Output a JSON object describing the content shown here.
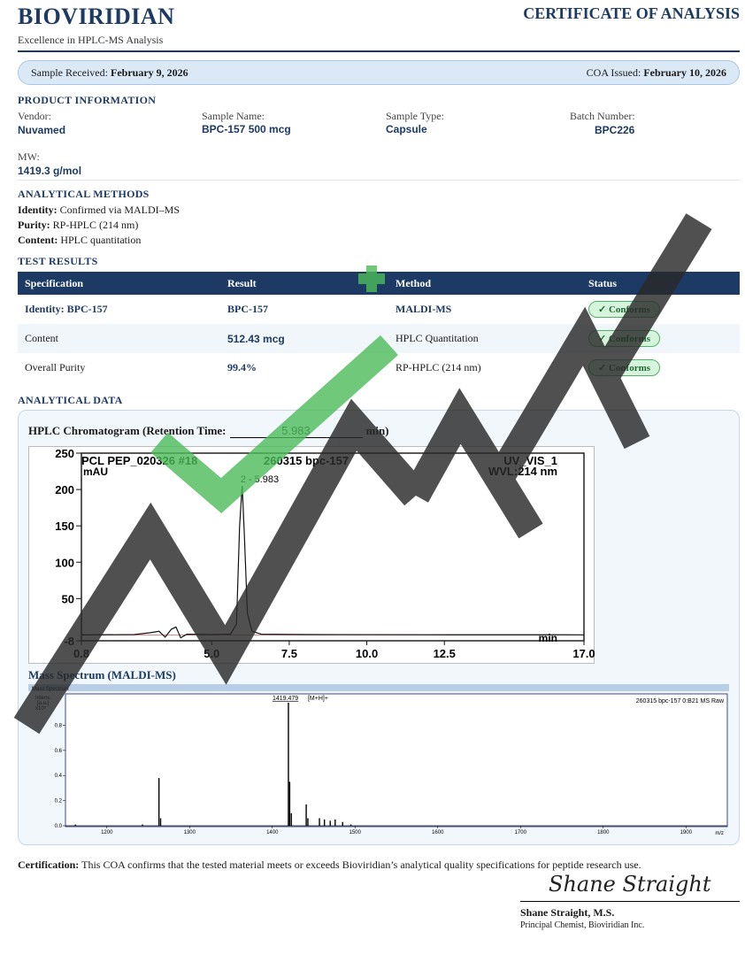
{
  "header": {
    "brand": "BIOVIRIDIAN",
    "tagline": "Excellence in HPLC-MS Analysis",
    "doc_title": "CERTIFICATE OF ANALYSIS"
  },
  "dates": {
    "received_label": "Sample Received:",
    "received_value": "February 9, 2026",
    "issued_label": "COA Issued:",
    "issued_value": "February 10, 2026"
  },
  "product": {
    "heading": "PRODUCT INFORMATION",
    "vendor_label": "Vendor:",
    "vendor": "Nuvamed",
    "sample_name_label": "Sample Name:",
    "sample_name": "BPC-157  500 mcg",
    "sample_type_label": "Sample Type:",
    "sample_type": "Capsule",
    "batch_label": "Batch Number:",
    "batch": "BPC226",
    "mw_label": "MW:",
    "mw": "1419.3  g/mol"
  },
  "methods": {
    "heading": "ANALYTICAL METHODS",
    "identity_label": "Identity:",
    "identity": "Confirmed via MALDI–MS",
    "purity_label": "Purity:",
    "purity": "RP-HPLC (214 nm)",
    "content_label": "Content:",
    "content": "HPLC quantitation"
  },
  "results": {
    "heading": "TEST RESULTS",
    "columns": [
      "Specification",
      "Result",
      "Method",
      "Status"
    ],
    "rows": [
      {
        "spec": "Identity:  BPC-157",
        "result": "BPC-157",
        "method": "MALDI-MS",
        "status": "✓ Conforms"
      },
      {
        "spec": "Content",
        "result": "512.43  mcg",
        "method": "HPLC Quantitation",
        "status": "✓ Conforms"
      },
      {
        "spec": "Overall Purity",
        "result": "99.4%",
        "method": "RP-HPLC (214 nm)",
        "status": "✓ Conforms"
      }
    ]
  },
  "analytical": {
    "heading": "ANALYTICAL DATA",
    "hplc_title_prefix": "HPLC Chromatogram (Retention Time:",
    "retention_time": "5.983",
    "hplc_title_suffix": "min)",
    "ms_title": "Mass Spectrum (MALDI-MS)"
  },
  "chart_data": [
    {
      "type": "line",
      "header_left": "PCL PEP_020326 #18",
      "header_mid": "260315 bpc-157",
      "header_right": "UV_VIS_1",
      "header_right2": "WVL:214 nm",
      "y_unit": "mAU",
      "x_unit": "min",
      "x_ticks": [
        "0.8",
        "5.0",
        "7.5",
        "10.0",
        "12.5",
        "17.0"
      ],
      "y_ticks": [
        "250",
        "200",
        "150",
        "100",
        "50",
        "-8"
      ],
      "xlim": [
        0.8,
        17.0
      ],
      "ylim": [
        -8,
        250
      ],
      "peak_label": "2 - 5.983",
      "x": [
        0.8,
        2.5,
        3.0,
        3.3,
        3.5,
        3.7,
        3.85,
        4.0,
        4.2,
        5.0,
        5.6,
        5.8,
        5.9,
        5.983,
        6.05,
        6.15,
        6.3,
        6.6,
        8.0,
        12.0,
        17.0
      ],
      "y": [
        0,
        0.5,
        3,
        5,
        -3,
        8,
        11,
        -4,
        1,
        0.5,
        1,
        15,
        150,
        205,
        140,
        30,
        5,
        1,
        0.5,
        0.3,
        0.2
      ]
    },
    {
      "type": "line",
      "header_tag": "Mass Spectrum",
      "header_right": "260315 bpc-157 0:B21 MS Raw",
      "y_label_1": "Intens.",
      "y_label_2": "[a.u.]",
      "y_label_3": "x10⁵",
      "x_unit": "m/z",
      "x_ticks": [
        "1200",
        "1300",
        "1400",
        "1500",
        "1600",
        "1700",
        "1800",
        "1900"
      ],
      "y_ticks": [
        "0.8",
        "0.6",
        "0.4",
        "0.2",
        "0.0"
      ],
      "xlim": [
        1150,
        1950
      ],
      "ylim": [
        0,
        1.05
      ],
      "peak_label": "1419.479",
      "peak_annotation": "[M+H]+",
      "peaks": [
        {
          "mz": 1162,
          "i": 0.01
        },
        {
          "mz": 1243,
          "i": 0.01
        },
        {
          "mz": 1263,
          "i": 0.38
        },
        {
          "mz": 1265,
          "i": 0.06
        },
        {
          "mz": 1419.479,
          "i": 0.98
        },
        {
          "mz": 1421,
          "i": 0.35
        },
        {
          "mz": 1423,
          "i": 0.1
        },
        {
          "mz": 1441,
          "i": 0.17
        },
        {
          "mz": 1443,
          "i": 0.06
        },
        {
          "mz": 1457,
          "i": 0.06
        },
        {
          "mz": 1463,
          "i": 0.05
        },
        {
          "mz": 1470,
          "i": 0.04
        },
        {
          "mz": 1476,
          "i": 0.05
        },
        {
          "mz": 1485,
          "i": 0.03
        },
        {
          "mz": 1495,
          "i": 0.01
        }
      ]
    }
  ],
  "certification": {
    "label": "Certification:",
    "text": "This COA confirms that the tested material meets or exceeds Bioviridian’s analytical quality specifications for peptide research use."
  },
  "signature": {
    "script": "Shane Straight",
    "name": "Shane Straight, M.S.",
    "title": "Principal Chemist, Bioviridian Inc."
  },
  "colors": {
    "navy": "#1c3a63",
    "conforms_green": "#d6f3dc",
    "watermark_gray": "#222222",
    "watermark_green": "#4cbb5a"
  }
}
